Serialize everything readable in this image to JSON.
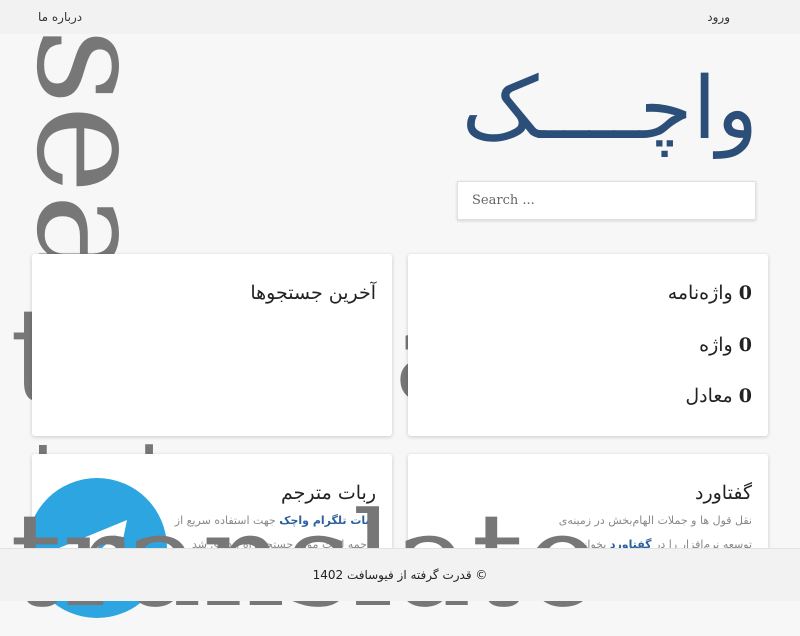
{
  "nav": {
    "login": "ورود",
    "about": "درباره ما"
  },
  "background_words": {
    "vertical": "search",
    "middle": "translate",
    "bottom": "translate"
  },
  "brand": {
    "title": "واچــــک",
    "color": "#2b4f78"
  },
  "search": {
    "placeholder": "Search ..."
  },
  "stats_card": {
    "items": [
      {
        "value": "0",
        "label": "واژه‌نامه"
      },
      {
        "value": "0",
        "label": "واژه"
      },
      {
        "value": "0",
        "label": "معادل"
      }
    ]
  },
  "recent_card": {
    "title": "آخرین جستجوها"
  },
  "conversation_card": {
    "title": "گفتاورد",
    "text_line1": "نقل قول ها و جملات الهام‌بخش در زمینه‌ی",
    "text_line2_pre": "توسعه نرم‌افزار را در",
    "text_line2_link": "گفتاورد",
    "text_line2_post": "بخوانید"
  },
  "bot_card": {
    "title": "ربات مترجم",
    "link": "ربات تلگرام واچک",
    "text_line1_post": "جهت استفاده سریع از",
    "text_line2": "ترجمه لغات مورد جستجو راه اندازی شد",
    "icon": "telegram-icon",
    "icon_color": "#2ca5e0"
  },
  "footer": {
    "text": "© قدرت گرفته از فیوسافت 1402"
  }
}
